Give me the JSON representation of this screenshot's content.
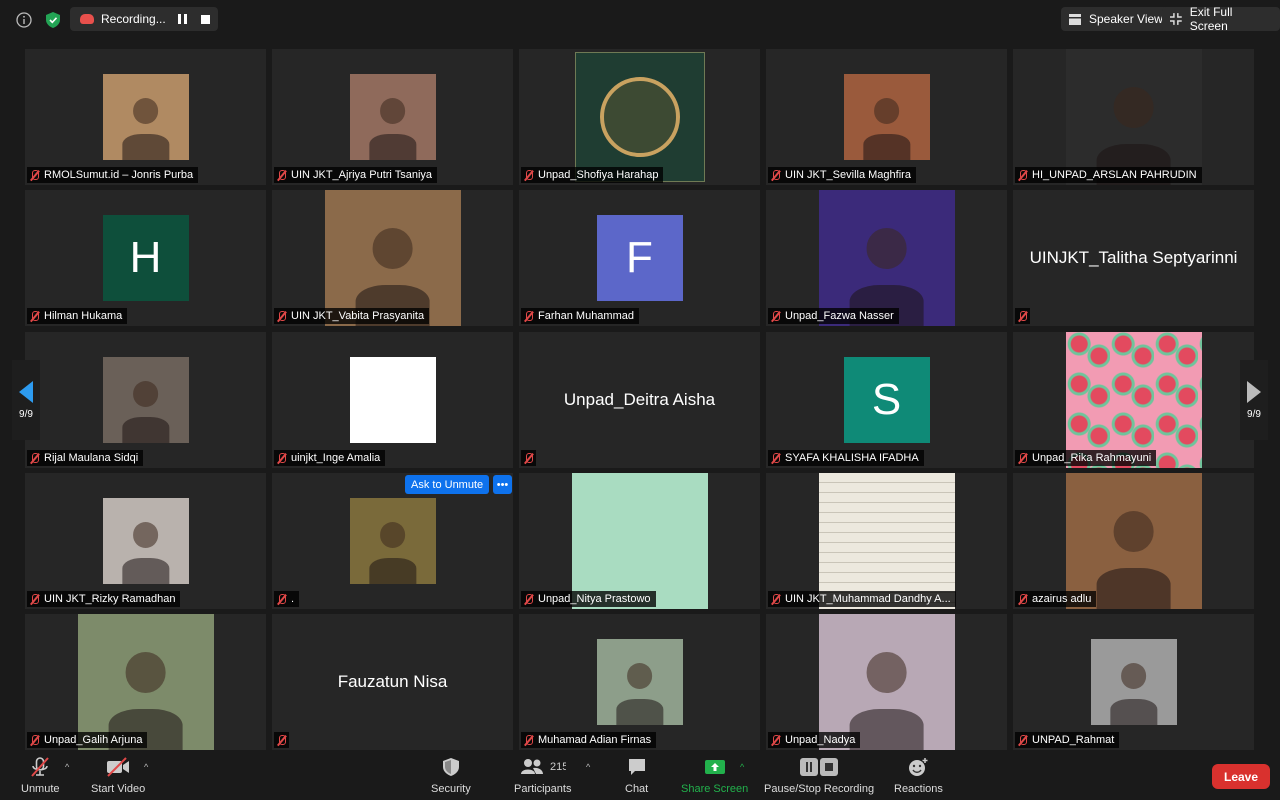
{
  "recording": {
    "label": "Recording..."
  },
  "top_buttons": {
    "speaker_view": "Speaker View",
    "exit_full_screen": "Exit Full Screen"
  },
  "pager": {
    "left": "9/9",
    "right": "9/9"
  },
  "ask_unmute": "Ask to Unmute",
  "tiles": [
    {
      "name": "RMOLSumut.id – Jonris Purba",
      "kind": "photo",
      "color": "#b08a62"
    },
    {
      "name": "UIN JKT_Ajriya Putri Tsaniya",
      "kind": "photo",
      "color": "#8f6a5b"
    },
    {
      "name": "Unpad_Shofiya Harahap",
      "kind": "emblem",
      "color": "#1f3d32"
    },
    {
      "name": "UIN JKT_Sevilla Maghfira",
      "kind": "photo",
      "color": "#9a5a3c"
    },
    {
      "name": "HI_UNPAD_ARSLAN PAHRUDIN",
      "kind": "photo",
      "color": "#2c2c2c"
    },
    {
      "name": "Hilman Hukama",
      "kind": "letter",
      "letter": "H",
      "color": "#0e4f3b"
    },
    {
      "name": "UIN JKT_Vabita Prasyanita",
      "kind": "photo",
      "color": "#8b6a4a"
    },
    {
      "name": "Farhan Muhammad",
      "kind": "letter",
      "letter": "F",
      "color": "#5c67c9"
    },
    {
      "name": "Unpad_Fazwa Nasser",
      "kind": "photo",
      "color": "#3b2a7a"
    },
    {
      "name": "",
      "kind": "text",
      "text": "UINJKT_Talitha Septyarinni"
    },
    {
      "name": "Rijal Maulana Sidqi",
      "kind": "photo",
      "color": "#6a6058"
    },
    {
      "name": "uinjkt_Inge Amalia",
      "kind": "white",
      "color": "#ffffff"
    },
    {
      "name": "",
      "kind": "text",
      "text": "Unpad_Deitra Aisha"
    },
    {
      "name": "SYAFA KHALISHA IFADHA",
      "kind": "letter",
      "letter": "S",
      "color": "#0f8a77"
    },
    {
      "name": "Unpad_Rika Rahmayuni",
      "kind": "pattern",
      "color": "#f29bb3"
    },
    {
      "name": "UIN JKT_Rizky Ramadhan",
      "kind": "photo",
      "color": "#b9b2ad"
    },
    {
      "name": ".",
      "kind": "photo",
      "color": "#7a6a3a"
    },
    {
      "name": "Unpad_Nitya Prastowo",
      "kind": "mint",
      "color": "#a9dcc1"
    },
    {
      "name": "UIN JKT_Muhammad Dandhy A...",
      "kind": "paper",
      "color": "#e7e3d8"
    },
    {
      "name": "azairus adlu",
      "kind": "photo",
      "color": "#8a6040"
    },
    {
      "name": "Unpad_Galih Arjuna",
      "kind": "photo",
      "color": "#7d8b6a"
    },
    {
      "name": "",
      "kind": "text",
      "text": "Fauzatun Nisa"
    },
    {
      "name": "Muhamad Adian Firnas",
      "kind": "photo",
      "color": "#8d9e8a"
    },
    {
      "name": "Unpad_Nadya",
      "kind": "photo",
      "color": "#b8a8b5"
    },
    {
      "name": "UNPAD_Rahmat",
      "kind": "photo",
      "color": "#9a9a9a"
    }
  ],
  "toolbar": {
    "unmute": "Unmute",
    "start_video": "Start Video",
    "security": "Security",
    "participants": "Participants",
    "participant_count": "215",
    "chat": "Chat",
    "share_screen": "Share Screen",
    "pause_stop_recording": "Pause/Stop Recording",
    "reactions": "Reactions",
    "leave": "Leave"
  },
  "colors": {
    "accent": "#0e72ed",
    "share": "#22b14c",
    "leave": "#d9312e",
    "mute": "#e04848"
  }
}
